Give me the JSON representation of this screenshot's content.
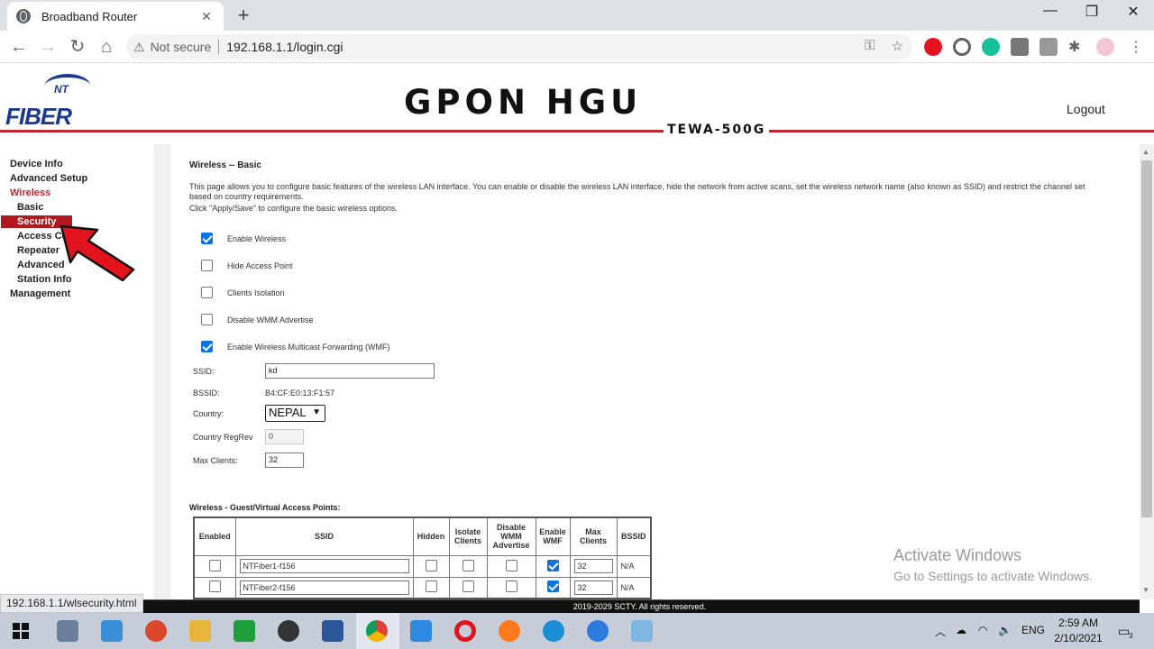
{
  "browser": {
    "tab_title": "Broadband Router",
    "tab_close": "✕",
    "new_tab": "+",
    "win_min": "—",
    "win_restore": "❐",
    "win_close": "✕",
    "not_secure": "Not secure",
    "url": "192.168.1.1/login.cgi",
    "status_url": "192.168.1.1/wlsecurity.html"
  },
  "header": {
    "logo_nt": "NT",
    "logo_fiber": "FIBER",
    "title": "GPON HGU",
    "model": "TEWA-500G",
    "logout": "Logout"
  },
  "sidebar": {
    "items": [
      {
        "label": "Device Info"
      },
      {
        "label": "Advanced Setup"
      },
      {
        "label": "Wireless"
      },
      {
        "label": "Basic"
      },
      {
        "label": "Security"
      },
      {
        "label": "Access Co"
      },
      {
        "label": "Repeater"
      },
      {
        "label": "Advanced"
      },
      {
        "label": "Station Info"
      },
      {
        "label": "Management"
      }
    ]
  },
  "main": {
    "title": "Wireless -- Basic",
    "description": "This page allows you to configure basic features of the wireless LAN interface. You can enable or disable the wireless LAN interface, hide the network from active scans, set the wireless network name (also known as SSID) and restrict the channel set based on country requirements.",
    "description2": "Click \"Apply/Save\" to configure the basic wireless options.",
    "checkboxes": [
      {
        "label": "Enable Wireless",
        "checked": true
      },
      {
        "label": "Hide Access Point",
        "checked": false
      },
      {
        "label": "Clients Isolation",
        "checked": false
      },
      {
        "label": "Disable WMM Advertise",
        "checked": false
      },
      {
        "label": "Enable Wireless Multicast Forwarding (WMF)",
        "checked": true
      }
    ],
    "ssid_label": "SSID:",
    "ssid_value": "kd",
    "bssid_label": "BSSID:",
    "bssid_value": "B4:CF:E0:13:F1:57",
    "country_label": "Country:",
    "country_value": "NEPAL",
    "regrev_label": "Country RegRev",
    "regrev_value": "0",
    "maxclients_label": "Max Clients:",
    "maxclients_value": "32",
    "vap_title": "Wireless - Guest/Virtual Access Points:",
    "vap_headers": [
      "Enabled",
      "SSID",
      "Hidden",
      "Isolate Clients",
      "Disable WMM Advertise",
      "Enable WMF",
      "Max Clients",
      "BSSID"
    ],
    "vap_rows": [
      {
        "enabled": false,
        "ssid": "NTFiber1-f156",
        "hidden": false,
        "isolate": false,
        "disable_wmm": false,
        "wmf": true,
        "max_clients": "32",
        "bssid": "N/A"
      },
      {
        "enabled": false,
        "ssid": "NTFiber2-f156",
        "hidden": false,
        "isolate": false,
        "disable_wmm": false,
        "wmf": true,
        "max_clients": "32",
        "bssid": "N/A"
      }
    ]
  },
  "footer": "2019-2029 SCTY. All rights reserved.",
  "watermark": {
    "line1": "Activate Windows",
    "line2": "Go to Settings to activate Windows."
  },
  "taskbar": {
    "lang": "ENG",
    "time": "2:59 AM",
    "date": "2/10/2021",
    "notif_count": "3"
  },
  "colors": {
    "brand_red": "#c0262f",
    "selected_menu": "#b3181f",
    "checkbox_blue": "#0b74de"
  }
}
